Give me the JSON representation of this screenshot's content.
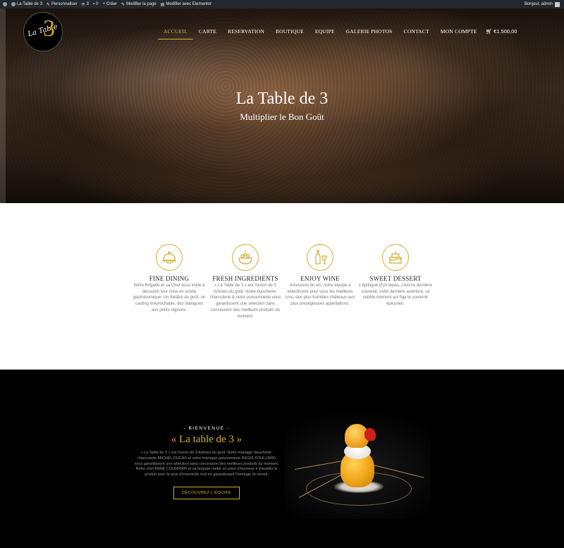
{
  "adminbar": {
    "site_name": "La Table de 3",
    "customize": "Personnaliser",
    "updates": "3",
    "comments": "0",
    "new": "Créer",
    "edit_page": "Modifier la page",
    "elementor": "Modifier avec Elementor",
    "greeting": "Bonjour, admin"
  },
  "logo": {
    "script_text": "La Table",
    "number": "3"
  },
  "nav": {
    "items": [
      {
        "label": "ACCUEIL"
      },
      {
        "label": "CARTE"
      },
      {
        "label": "RESERVATION"
      },
      {
        "label": "BOUTIQUE"
      },
      {
        "label": "EQUIPE"
      },
      {
        "label": "GALERIE PHOTOS"
      },
      {
        "label": "CONTACT"
      },
      {
        "label": "MON COMPTE"
      }
    ],
    "cart_amount": "€1.500,00"
  },
  "hero": {
    "title": "La Table de 3",
    "subtitle": "Multiplier le Bon Goût"
  },
  "features": [
    {
      "title": "FINE DINING",
      "text": "Notre Brigade et sa Chef vous invite à découvrir leur mise en scène gastronomique. Un théâtre du goût, un casting irréprochable, des dialogues aux petits oignons.",
      "icon": "cloche-icon"
    },
    {
      "title": "FRESH INGREDIENTS",
      "text": "« La Table de 3 » est l'union de 3 Artistes du goût. Notre boucherie-charcuterie & notre poissonnerie vous garantissent une sélection sans concession des meilleurs produits du moment.",
      "icon": "salad-bowl-icon"
    },
    {
      "title": "ENJOY WINE",
      "text": "Amoureux du vin, notre équipe a sélectionné pour vous les meilleurs crus, des plus humbles châteaux aux plus prestigieuses appellations.",
      "icon": "wine-bottle-icon"
    },
    {
      "title": "SWEET DESSERT",
      "text": "L'épilogue d'un repas, c'est ce dernière souvenir, cette dernière aventure, ce subtile moment qui fige le souvenir épicurien.",
      "icon": "cake-icon"
    }
  ],
  "welcome": {
    "kicker": "- BIENVENUE -",
    "title": "« La table de 3 »",
    "text": "« La Table de 3 » est l'union de 3 Artistes du goût. Notre manager boucherie-charcuterie MICHEL DUCAS et notre manager poissonnerie REGIS POULLARD vous garantissent une sélection sans concession des meilleurs produits du moment. Notre chef ANNE COURRIER et sa brigade mette un point d'honneur à travailler le produit avec le plus d'inventivité tout en garantissant l'héritage du terroir.",
    "button": "DÉCOUVREZ L'ÉQUIPE"
  },
  "colors": {
    "gold": "#d4af37",
    "adminbar": "#23282d",
    "dark_section": "#000000"
  }
}
